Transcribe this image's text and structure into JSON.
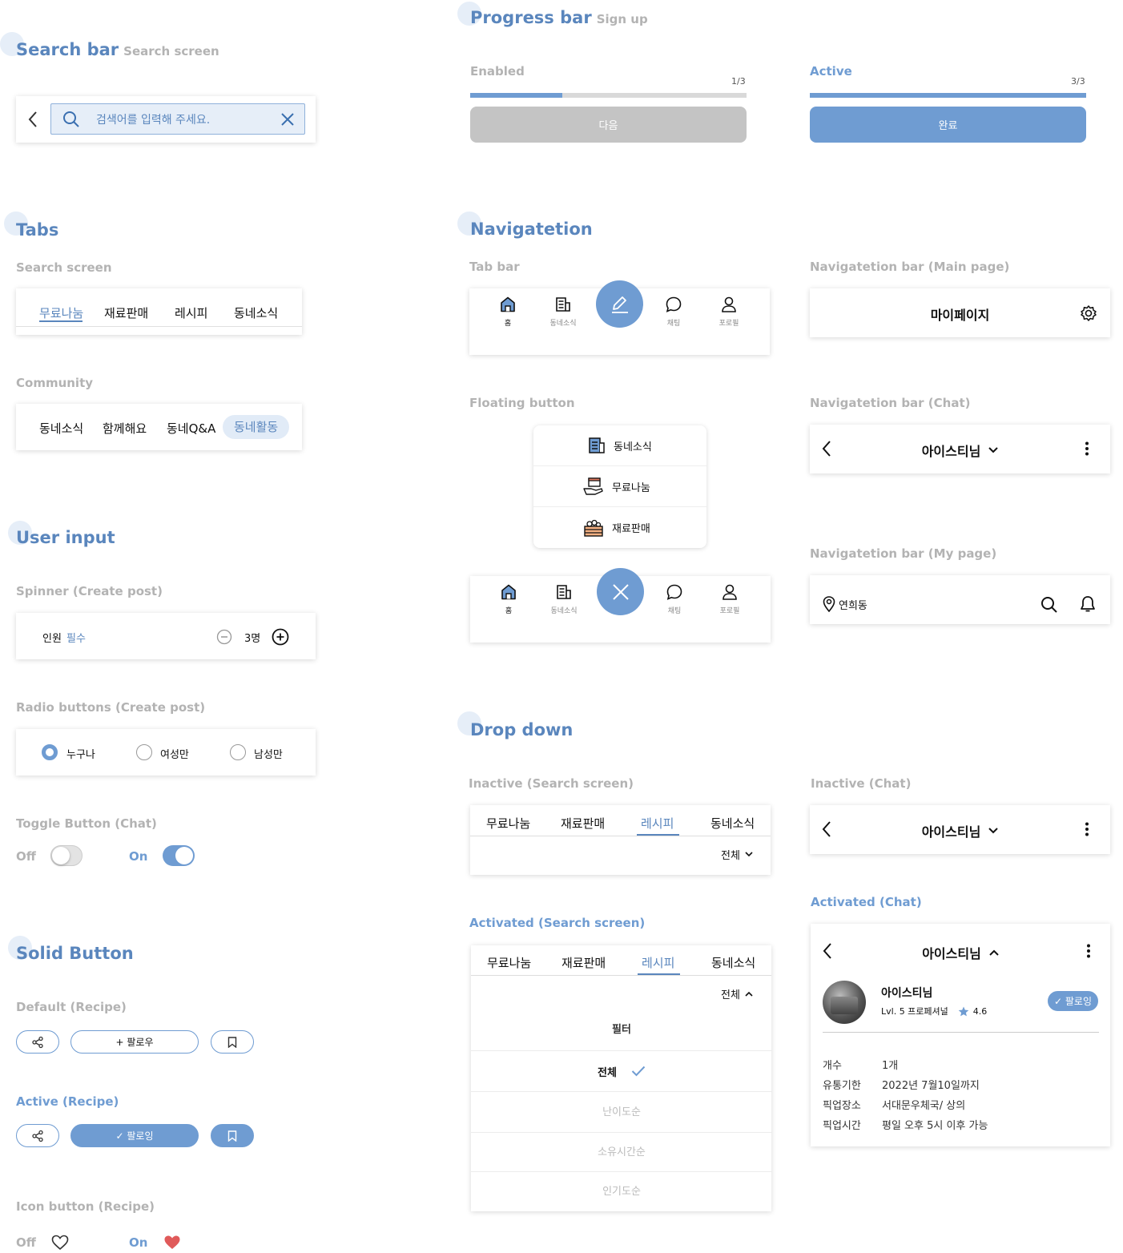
{
  "colors": {
    "accent": "#6f9cd2",
    "muted": "#b3b3b3",
    "heart": "#e05a5a"
  },
  "search": {
    "title": "Search bar",
    "subtitle": "Search screen",
    "placeholder": "검색어를 입력해 주세요.",
    "icons": [
      "chevron-left-icon",
      "search-icon",
      "close-icon"
    ]
  },
  "tabs": {
    "title": "Tabs",
    "search_label": "Search screen",
    "search_tabs": [
      "무료나눔",
      "재료판매",
      "레시피",
      "동네소식"
    ],
    "community_label": "Community",
    "community_tabs": [
      "동네소식",
      "함께해요",
      "동네Q&A",
      "동네활동"
    ]
  },
  "user_input": {
    "title": "User input",
    "spinner_label": "Spinner (Create post)",
    "spinner_field": "인원",
    "spinner_required": "필수",
    "spinner_value": "3명",
    "radio_label": "Radio buttons (Create post)",
    "radio_options": [
      "누구나",
      "여성만",
      "남성만"
    ],
    "radio_selected": "누구나",
    "toggle_label": "Toggle Button (Chat)",
    "toggle_off": "Off",
    "toggle_on": "On"
  },
  "solid": {
    "title": "Solid Button",
    "default_label": "Default (Recipe)",
    "follow": "+ 팔로우",
    "active_label": "Active (Recipe)",
    "following": "✓ 팔로잉",
    "icon_label": "Icon button (Recipe)",
    "off": "Off",
    "on": "On"
  },
  "progress": {
    "title": "Progress bar",
    "subtitle": "Sign up",
    "enabled_label": "Enabled",
    "enabled_count": "1/3",
    "enabled_fraction": 0.333,
    "enabled_button": "다음",
    "active_label": "Active",
    "active_count": "3/3",
    "active_fraction": 1.0,
    "active_button": "완료"
  },
  "nav": {
    "title": "Navigatetion",
    "tabbar_label": "Tab bar",
    "items": [
      "홈",
      "동네소식",
      "채팅",
      "포로필"
    ],
    "floating_label": "Floating button",
    "floating_items": [
      "동네소식",
      "무료나눔",
      "재료판매"
    ],
    "main_label": "Navigatetion bar (Main page)",
    "main_title": "마이페이지",
    "chat_label": "Navigatetion bar (Chat)",
    "chat_title": "아이스티님",
    "mypage_label": "Navigatetion bar (My page)",
    "location": "연희동"
  },
  "dropdown": {
    "title": "Drop down",
    "inactive_search_label": "Inactive (Search screen)",
    "tabs": [
      "무료나눔",
      "재료판매",
      "레시피",
      "동네소식"
    ],
    "active_tab": "레시피",
    "filter_value": "전체",
    "activated_search_label": "Activated (Search screen)",
    "menu_header": "필터",
    "menu_items": [
      "전체",
      "난이도순",
      "소유시간순",
      "인기도순"
    ],
    "menu_selected": "전체",
    "inactive_chat_label": "Inactive (Chat)",
    "chat_title": "아이스티님",
    "activated_chat_label": "Activated (Chat)",
    "profile_name": "아이스티님",
    "profile_level": "Lvl. 5 프로페셔널",
    "profile_rating": "4.6",
    "follow_badge": "✓ 팔로잉",
    "info": [
      [
        "개수",
        "1개"
      ],
      [
        "유통기한",
        "2022년 7월10일까지"
      ],
      [
        "픽업장소",
        "서대문우체국/ 상의"
      ],
      [
        "픽업시간",
        "평일 오후 5시 이후 가능"
      ]
    ]
  }
}
